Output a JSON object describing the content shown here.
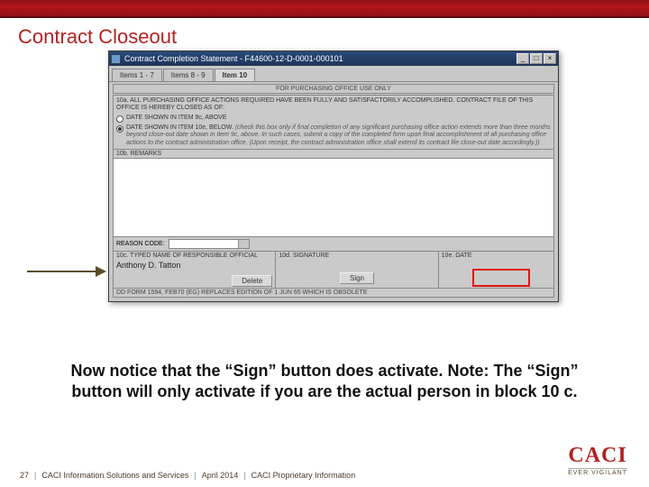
{
  "slide": {
    "title": "Contract Closeout"
  },
  "window": {
    "title": "Contract Completion Statement - F44600-12-D-0001-000101",
    "tabs": [
      "Items 1 - 7",
      "Items 8 - 9",
      "Item 10"
    ],
    "active_tab": 2,
    "purchasing_header": "FOR PURCHASING OFFICE USE ONLY",
    "sec10a_text": "10a. ALL PURCHASING OFFICE ACTIONS REQUIRED HAVE BEEN FULLY AND SATISFACTORILY ACCOMPLISHED. CONTRACT FILE OF THIS OFFICE IS HEREBY CLOSED AS OF:",
    "radio1": "DATE SHOWN IN ITEM 9c, ABOVE",
    "radio2_lead": "DATE SHOWN IN ITEM 10e, BELOW.",
    "radio2_note": "(check this box only if final completion of any significant purchasing office action extends more than three months beyond close-out date shown in Item 9c, above.  In such cases, submit a copy of the completed form upon final accomplishment of all purchasing office actions to the contract administration office.  (Upon receipt, the contract administration office shall extend its contract file close-out date accordingly.))",
    "sec10b_label": "10b. REMARKS",
    "reason_label": "REASON CODE:",
    "sig": {
      "c_label": "10c. TYPED NAME OF RESPONSIBLE OFFICIAL",
      "c_value": "Anthony D. Tatton",
      "d_label": "10d. SIGNATURE",
      "e_label": "10e. DATE",
      "delete_btn": "Delete",
      "sign_btn": "Sign"
    },
    "dd_footer": "DD FORM 1594, FEB70 (EG)      REPLACES EDITION OF 1 JUN 65 WHICH IS OBSOLETE"
  },
  "caption": "Now notice that the “Sign” button does activate.  Note: The “Sign” button will only activate if you are the actual person in block 10 c.",
  "footer": {
    "page": "27",
    "org": "CACI Information Solutions and Services",
    "date": "April 2014",
    "prop": "CACI Proprietary Information"
  },
  "logo": {
    "name": "CACI",
    "tag": "EVER VIGILANT"
  }
}
